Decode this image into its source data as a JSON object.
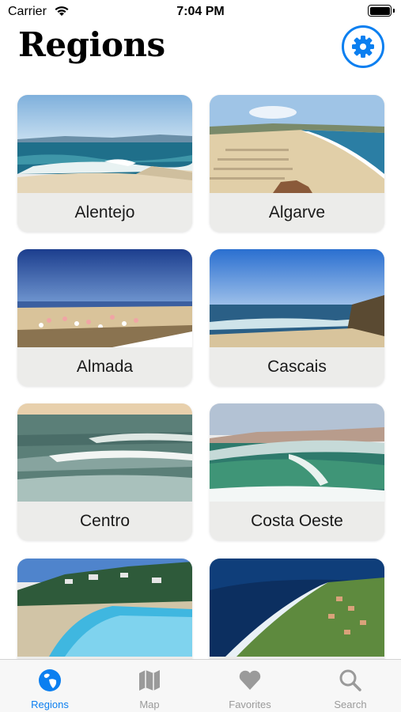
{
  "status_bar": {
    "carrier": "Carrier",
    "time": "7:04 PM"
  },
  "header": {
    "title": "Regions",
    "settings_icon": "gear-icon"
  },
  "regions": [
    {
      "name": "Alentejo"
    },
    {
      "name": "Algarve"
    },
    {
      "name": "Almada"
    },
    {
      "name": "Cascais"
    },
    {
      "name": "Centro"
    },
    {
      "name": "Costa Oeste"
    },
    {
      "name": ""
    },
    {
      "name": ""
    }
  ],
  "tab_bar": {
    "tabs": [
      {
        "label": "Regions",
        "icon": "globe-icon",
        "selected": true
      },
      {
        "label": "Map",
        "icon": "map-icon",
        "selected": false
      },
      {
        "label": "Favorites",
        "icon": "heart-icon",
        "selected": false
      },
      {
        "label": "Search",
        "icon": "search-icon",
        "selected": false
      }
    ]
  },
  "colors": {
    "accent": "#0b7ff0",
    "tab_inactive": "#9a9a9a",
    "card_label_bg": "#ececea"
  }
}
